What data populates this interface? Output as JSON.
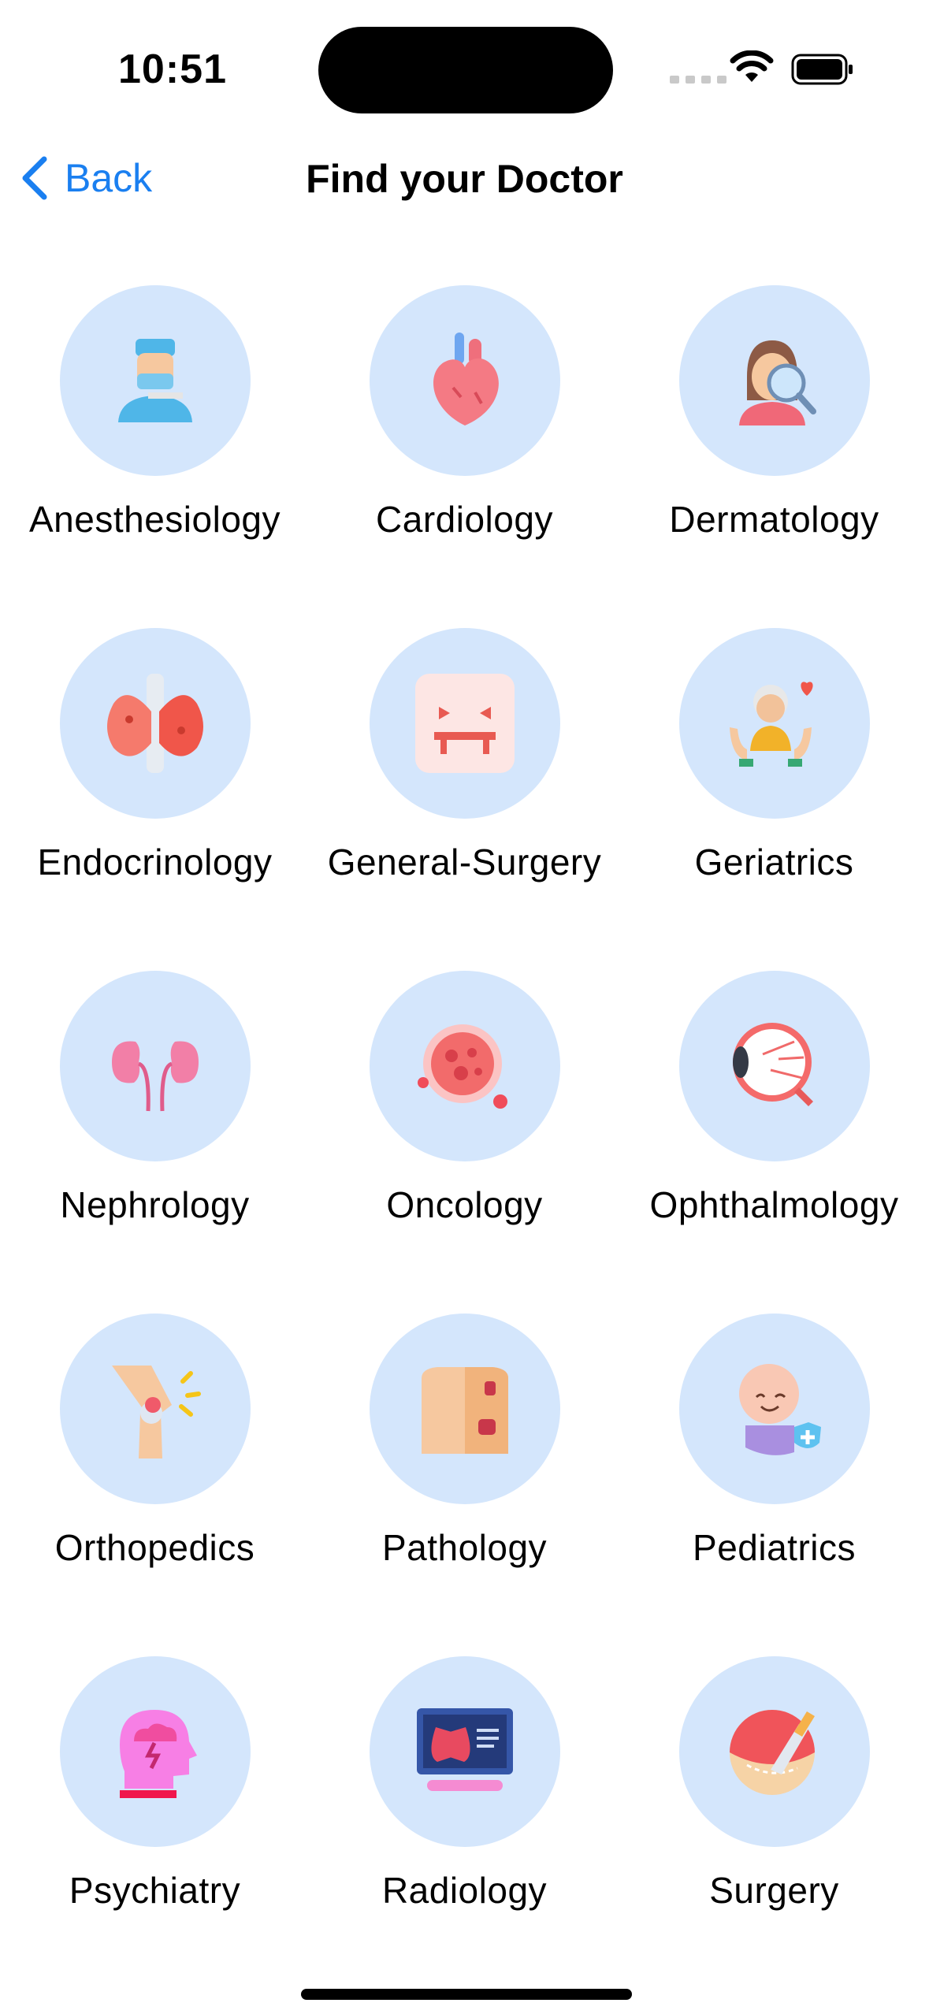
{
  "status_bar": {
    "time": "10:51"
  },
  "nav": {
    "back_label": "Back",
    "title": "Find your Doctor"
  },
  "specialties": [
    {
      "label": "Anesthesiology",
      "icon": "anesthesiologist-icon"
    },
    {
      "label": "Cardiology",
      "icon": "heart-icon"
    },
    {
      "label": "Dermatology",
      "icon": "skin-magnifier-icon"
    },
    {
      "label": "Endocrinology",
      "icon": "thyroid-icon"
    },
    {
      "label": "General-Surgery",
      "icon": "surgery-face-icon"
    },
    {
      "label": "Geriatrics",
      "icon": "elderly-care-icon"
    },
    {
      "label": "Nephrology",
      "icon": "kidneys-icon"
    },
    {
      "label": "Oncology",
      "icon": "cancer-cell-icon"
    },
    {
      "label": "Ophthalmology",
      "icon": "eyeball-icon"
    },
    {
      "label": "Orthopedics",
      "icon": "knee-joint-icon"
    },
    {
      "label": "Pathology",
      "icon": "torso-icon"
    },
    {
      "label": "Pediatrics",
      "icon": "baby-icon"
    },
    {
      "label": "Psychiatry",
      "icon": "head-storm-icon"
    },
    {
      "label": "Radiology",
      "icon": "lungs-xray-icon"
    },
    {
      "label": "Surgery",
      "icon": "scalpel-icon"
    }
  ]
}
